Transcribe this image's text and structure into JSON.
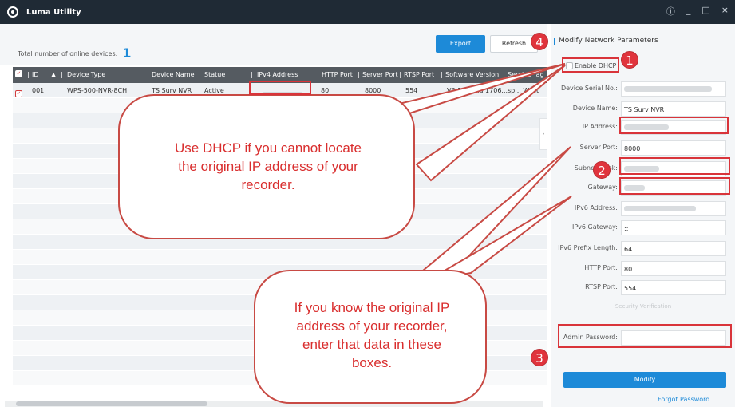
{
  "app": {
    "title": "Luma Utility"
  },
  "window": {
    "info_icon": "ⓘ",
    "min": "_",
    "max": "□",
    "close": "×"
  },
  "list": {
    "online_label": "Total number of online devices:",
    "online_count": "1",
    "export_label": "Export",
    "refresh_label": "Refresh",
    "columns": [
      "ID",
      "Device Type",
      "Device Name",
      "Statue",
      "IPv4 Address",
      "HTTP Port",
      "Server Port",
      "RTSP Port",
      "Software Version",
      "Service Tag"
    ],
    "rows": [
      {
        "id": "001",
        "device_type": "WPS-500-NVR-8CH",
        "device_name": "TS Surv NVR",
        "status": "Active",
        "http": "80",
        "server": "8000",
        "rtsp": "554",
        "software": "V3.1.2build 1706...",
        "tag": "sp... West"
      }
    ]
  },
  "panel": {
    "title": "Modify Network Parameters",
    "enable_dhcp": "Enable DHCP",
    "fields": [
      {
        "label": "Device Serial No.:",
        "value": ""
      },
      {
        "label": "Device Name:",
        "value": "TS Surv NVR"
      },
      {
        "label": "IP Address:",
        "value": ""
      },
      {
        "label": "Server Port:",
        "value": "8000"
      },
      {
        "label": "Subnet Mask:",
        "value": ""
      },
      {
        "label": "Gateway:",
        "value": ""
      },
      {
        "label": "IPv6 Address:",
        "value": ""
      },
      {
        "label": "IPv6 Gateway:",
        "value": "::"
      },
      {
        "label": "IPv6 Prefix Length:",
        "value": "64"
      },
      {
        "label": "HTTP Port:",
        "value": "80"
      },
      {
        "label": "RTSP Port:",
        "value": "554"
      }
    ],
    "security_label": "Security Verification",
    "admin_password_label": "Admin Password:",
    "admin_password_value": "",
    "modify_label": "Modify",
    "forgot_label": "Forgot Password"
  },
  "annotations": {
    "markers": [
      "1",
      "2",
      "3",
      "4"
    ],
    "callout_dhcp": "Use DHCP if you cannot locate the original IP address of your recorder.",
    "callout_ip": "If you know the original IP address of your recorder, enter that data in these boxes.",
    "color": "#d9343a"
  }
}
